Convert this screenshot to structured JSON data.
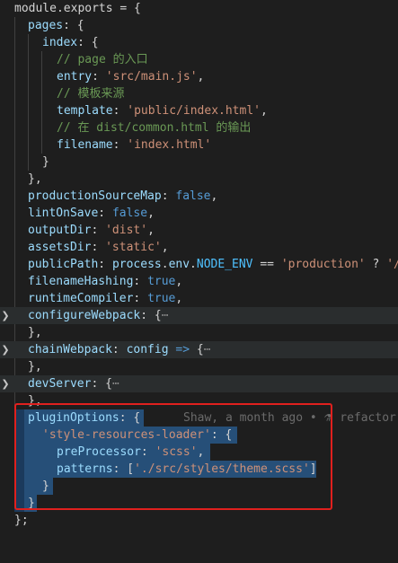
{
  "editor": {
    "line1": {
      "text": "module.exports = {"
    },
    "line2": {
      "key": "pages",
      "punct": ": {"
    },
    "line3": {
      "key": "index",
      "punct": ": {"
    },
    "line4": {
      "comment": "// page 的入口"
    },
    "line5": {
      "key": "entry",
      "colon": ": ",
      "value": "'src/main.js'",
      "comma": ","
    },
    "line6": {
      "comment": "// 模板来源"
    },
    "line7": {
      "key": "template",
      "colon": ": ",
      "value": "'public/index.html'",
      "comma": ","
    },
    "line8": {
      "comment": "// 在 dist/common.html 的输出"
    },
    "line9": {
      "key": "filename",
      "colon": ": ",
      "value": "'index.html'"
    },
    "line10": {
      "punct": "}"
    },
    "line11": {
      "punct": "},"
    },
    "line12": {
      "key": "productionSourceMap",
      "colon": ": ",
      "value": "false",
      "comma": ","
    },
    "line13": {
      "key": "lintOnSave",
      "colon": ": ",
      "value": "false",
      "comma": ","
    },
    "line14": {
      "key": "outputDir",
      "colon": ": ",
      "value": "'dist'",
      "comma": ","
    },
    "line15": {
      "key": "assetsDir",
      "colon": ": ",
      "value": "'static'",
      "comma": ","
    },
    "line16": {
      "key": "publicPath",
      "colon": ": ",
      "process": "process",
      "dot1": ".",
      "env": "env",
      "dot2": ".",
      "node_env": "NODE_ENV",
      "eq": " == ",
      "value": "'production'",
      "tern": " ? ",
      "tail": "'/"
    },
    "line17": {
      "key": "filenameHashing",
      "colon": ": ",
      "value": "true",
      "comma": ","
    },
    "line18": {
      "key": "runtimeCompiler",
      "colon": ": ",
      "value": "true",
      "comma": ","
    },
    "line19": {
      "key": "configureWebpack",
      "punct": ": {",
      "dots": "⋯"
    },
    "line20": {
      "punct": "},"
    },
    "line21": {
      "key": "chainWebpack",
      "colon": ": ",
      "param": "config",
      "arrow": " => ",
      "brace": "{",
      "dots": "⋯"
    },
    "line22": {
      "punct": "},"
    },
    "line23": {
      "key": "devServer",
      "punct": ": {",
      "dots": "⋯"
    },
    "line24": {
      "punct": "},"
    },
    "line25": {
      "key": "pluginOptions",
      "punct": ": {",
      "blame": "Shaw, a month ago •",
      "blame_msg": "refactor"
    },
    "line26": {
      "value": "'style-resources-loader'",
      "punct": ": {"
    },
    "line27": {
      "key": "preProcessor",
      "colon": ": ",
      "value": "'scss'",
      "comma": ","
    },
    "line28": {
      "key": "patterns",
      "colon": ": ",
      "open": "[",
      "value": "'./src/styles/theme.scss'",
      "close": "]"
    },
    "line29": {
      "punct": "}"
    },
    "line30": {
      "punct": "}"
    },
    "line31": {
      "punct": "};"
    }
  },
  "colors": {
    "background": "#1e1e1e",
    "selection": "#264f78",
    "annotation_border": "#e0201e"
  },
  "icons": {
    "fold": "chevron-right-icon",
    "blame": "git-commit-icon"
  }
}
